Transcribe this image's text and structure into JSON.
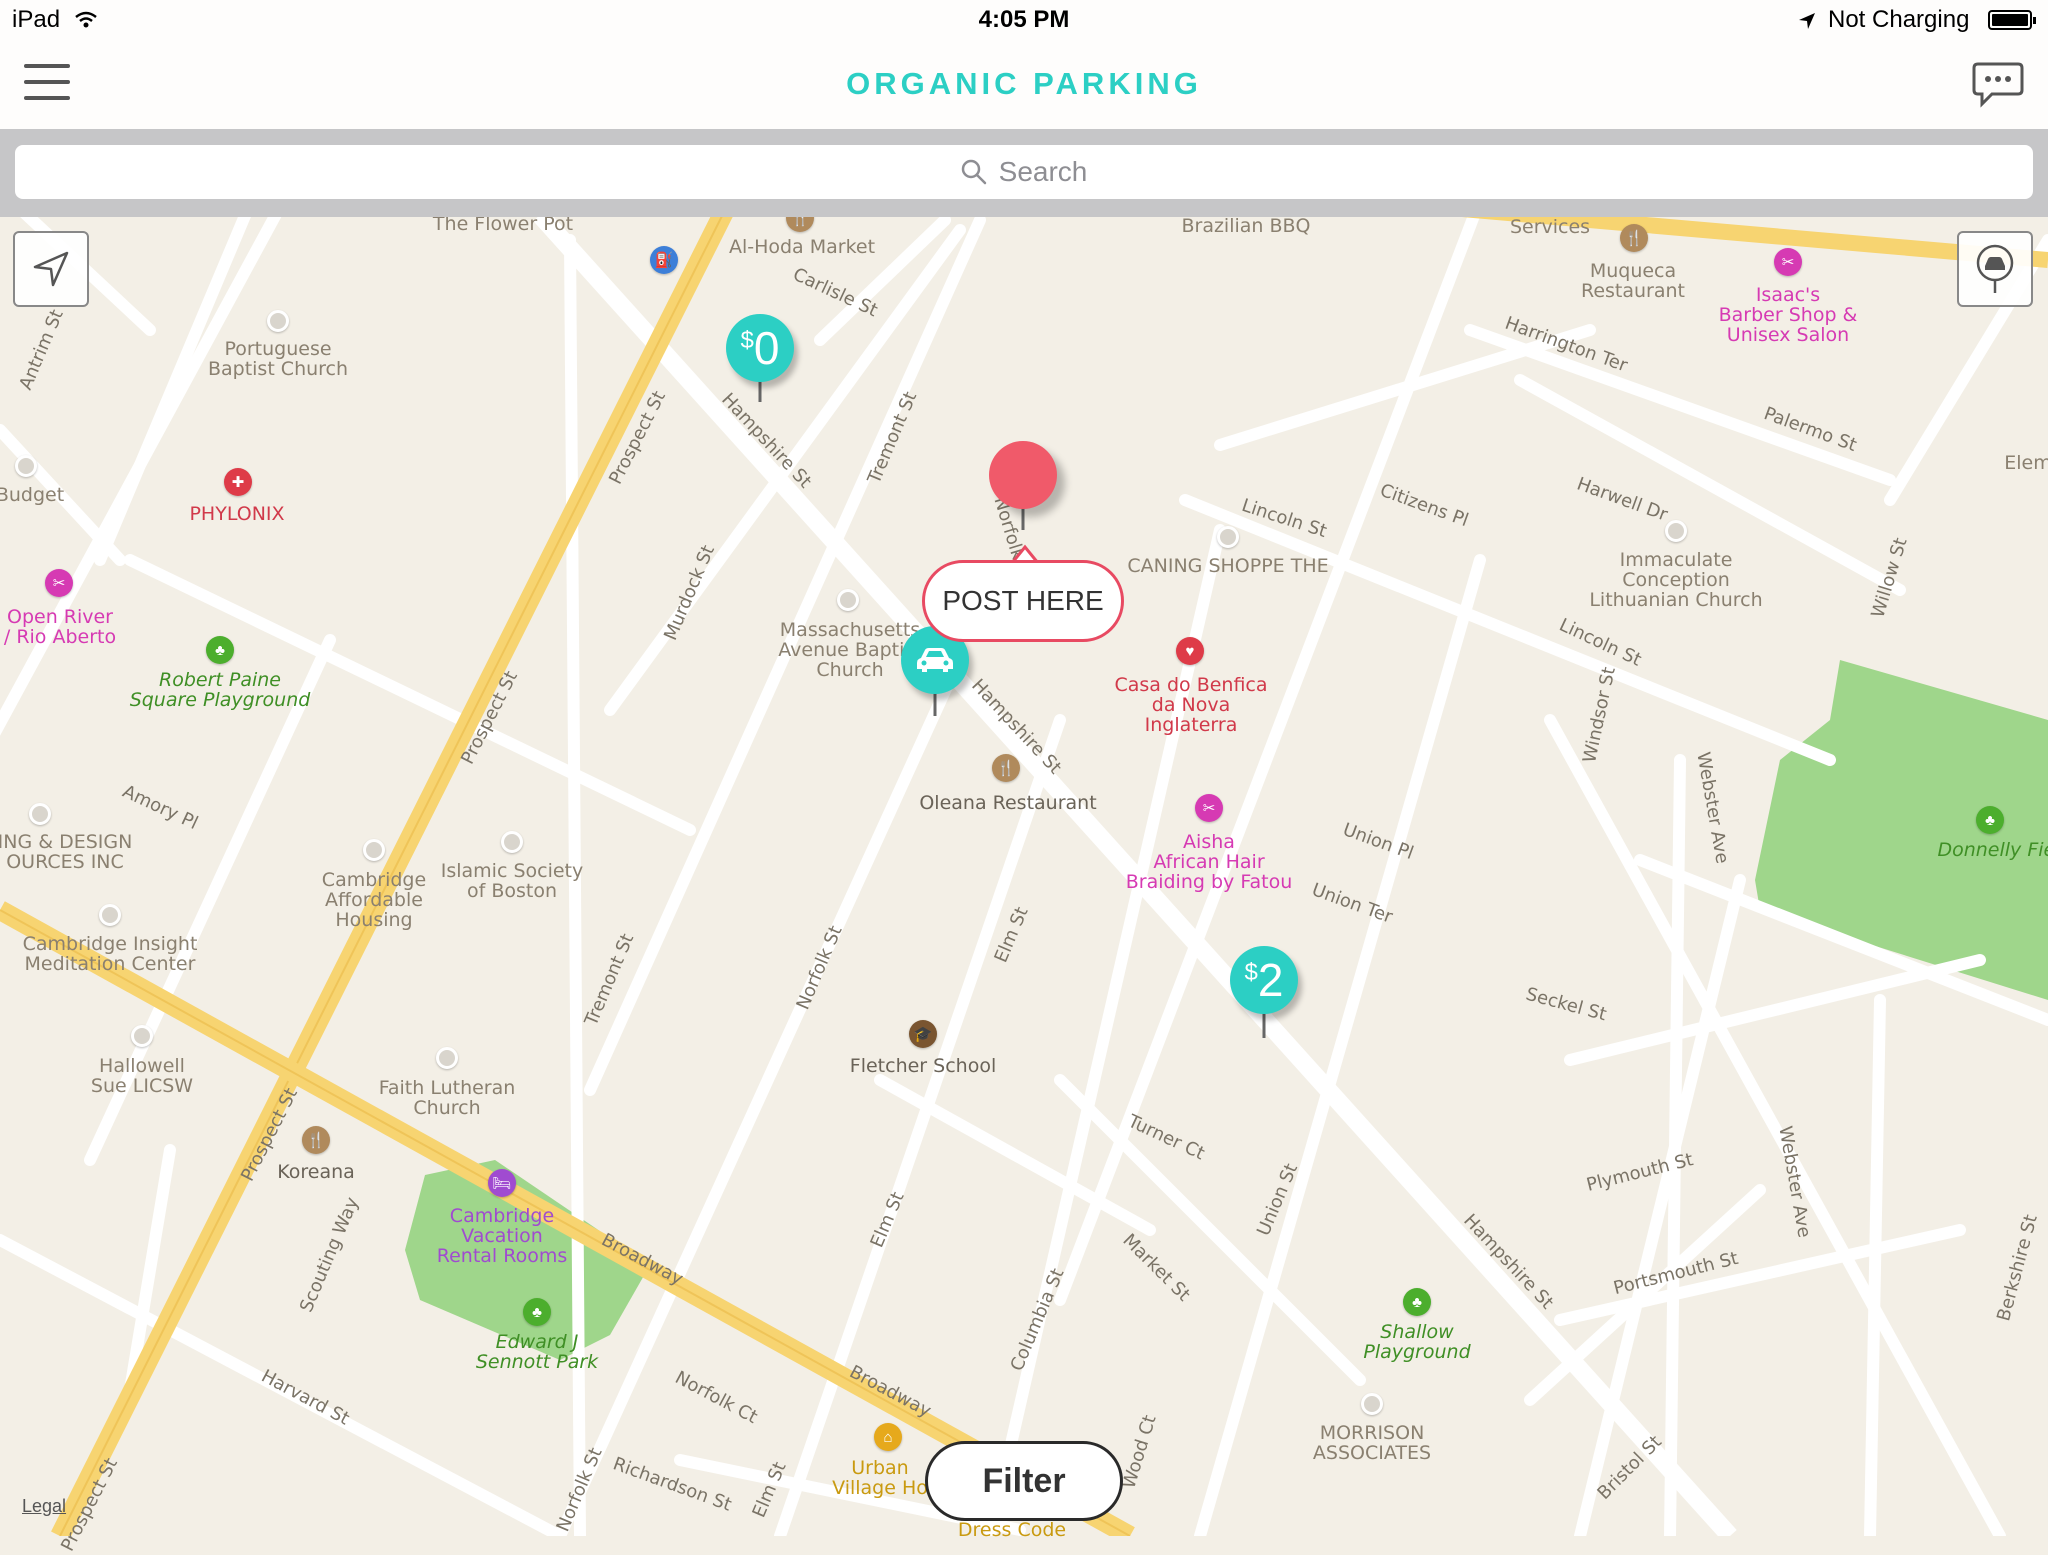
{
  "status_bar": {
    "device": "iPad",
    "time": "4:05 PM",
    "battery": "Not Charging"
  },
  "nav": {
    "title": "ORGANIC PARKING",
    "menu_icon": "hamburger-menu-icon",
    "chat_icon": "chat-bubble-icon"
  },
  "search": {
    "placeholder": "Search"
  },
  "map_controls": {
    "locate_icon": "location-arrow-icon",
    "car_icon": "car-pin-icon"
  },
  "pins": [
    {
      "currency": "$",
      "amount": "0"
    },
    {
      "currency": "$",
      "amount": "2"
    }
  ],
  "post_here_label": "POST HERE",
  "filter_label": "Filter",
  "legal_label": "Legal",
  "colors": {
    "accent": "#2ccfc4",
    "drop_pin": "#f05a6a",
    "bubble_border": "#e84a62"
  },
  "map_labels": {
    "flower_pot": "The Flower Pot",
    "al_hoda": "Al-Hoda Market",
    "brazilian_bbq": "Brazilian BBQ",
    "services": "Services",
    "muqueca": "Muqueca\nRestaurant",
    "isaacs": "Isaac's\nBarber Shop &\nUnisex Salon",
    "portuguese": "Portuguese\nBaptist Church",
    "phylonix": "PHYLONIX",
    "budget": "Budget",
    "open_river": "Open River\n/ Rio Aberto",
    "robert_paine": "Robert Paine\nSquare Playground",
    "caning": "CANING SHOPPE THE",
    "mass_ave": "Massachusetts\nAvenue Baptist\nChurch",
    "casa_benfica": "Casa do Benfica\nda Nova\nInglaterra",
    "oleana": "Oleana Restaurant",
    "aisha": "Aisha\nAfrican Hair\nBraiding by Fatou",
    "immaculate": "Immaculate\nConception\nLithuanian Church",
    "donnelly": "Donnelly Field",
    "design": "ING & DESIGN\nOURCES INC",
    "cambridge_housing": "Cambridge\nAffordable\nHousing",
    "islamic": "Islamic Society\nof Boston",
    "insight": "Cambridge Insight\nMeditation Center",
    "hallowell": "Hallowell\nSue LICSW",
    "faith": "Faith Lutheran\nChurch",
    "koreana": "Koreana",
    "fletcher": "Fletcher School",
    "vacation": "Cambridge\nVacation\nRental Rooms",
    "sennott": "Edward J\nSennott Park",
    "shallow": "Shallow\nPlayground",
    "morrison": "MORRISON\nASSOCIATES",
    "urban": "Urban\nVillage Ho",
    "elem": "Elem",
    "dress": "Dress Code"
  },
  "streets": {
    "hampshire": "Hampshire St",
    "prospect": "Prospect St",
    "broadway": "Broadway",
    "carlisle": "Carlisle St",
    "tremont": "Tremont St",
    "norfolk": "Norfolk St",
    "murdock": "Murdock St",
    "elm": "Elm St",
    "columbia": "Columbia St",
    "union": "Union St",
    "lincoln": "Lincoln St",
    "citizens": "Citizens Pl",
    "harrington": "Harrington Ter",
    "harwell": "Harwell Dr",
    "palermo": "Palermo St",
    "willow": "Willow St",
    "windsor": "Windsor St",
    "webster": "Webster Ave",
    "seckel": "Seckel St",
    "union_pl": "Union Pl",
    "union_ter": "Union Ter",
    "turner": "Turner Ct",
    "market": "Market St",
    "plymouth": "Plymouth St",
    "portsmouth": "Portsmouth St",
    "bristol": "Bristol St",
    "berkshire": "Berkshire St",
    "amory": "Amory Pl",
    "harvard": "Harvard St",
    "richardson": "Richardson St",
    "norfolk_ct": "Norfolk Ct",
    "scouting": "Scouting Way",
    "antrim": "Antrim St",
    "wood": "Wood Ct"
  }
}
